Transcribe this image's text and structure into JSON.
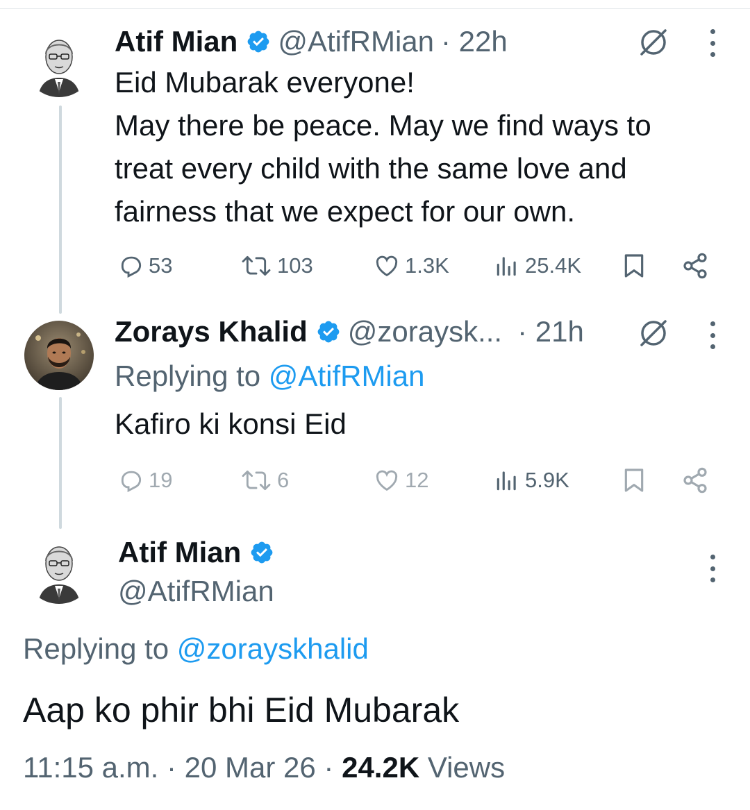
{
  "tweets": [
    {
      "name": "Atif Mian",
      "handle": "@AtifRMian",
      "time": "· 22h",
      "lines": [
        "Eid Mubarak everyone!",
        "May there be peace. May we find ways to",
        "treat every child with the same love and",
        "fairness that we expect for our own."
      ],
      "stats": {
        "replies": "53",
        "reposts": "103",
        "likes": "1.3K",
        "views": "25.4K"
      }
    },
    {
      "name": "Zorays Khalid",
      "handle": "@zoraysk...",
      "time": "· 21h",
      "replying_prefix": "Replying to",
      "replying_to": "@AtifRMian",
      "lines": [
        "Kafiro ki konsi Eid"
      ],
      "stats": {
        "replies": "19",
        "reposts": "6",
        "likes": "12",
        "views": "5.9K"
      }
    }
  ],
  "focused": {
    "name": "Atif Mian",
    "handle": "@AtifRMian",
    "replying_prefix": "Replying to",
    "replying_to": "@zorayskhalid",
    "text": "Aap ko phir bhi Eid Mubarak",
    "time": "11:15 a.m. · 20 Mar 26 ·",
    "views_count": "24.2K",
    "views_label": "Views"
  },
  "icons": {
    "verified": "verified-badge-icon",
    "grok": "grok-icon",
    "more": "more-icon",
    "reply": "reply-icon",
    "repost": "repost-icon",
    "like": "heart-icon",
    "views": "views-icon",
    "bookmark": "bookmark-icon",
    "share": "share-icon"
  },
  "colors": {
    "accent": "#1d9bf0",
    "text": "#0f1419",
    "muted": "#536471",
    "thread_line": "#cfd9de"
  }
}
